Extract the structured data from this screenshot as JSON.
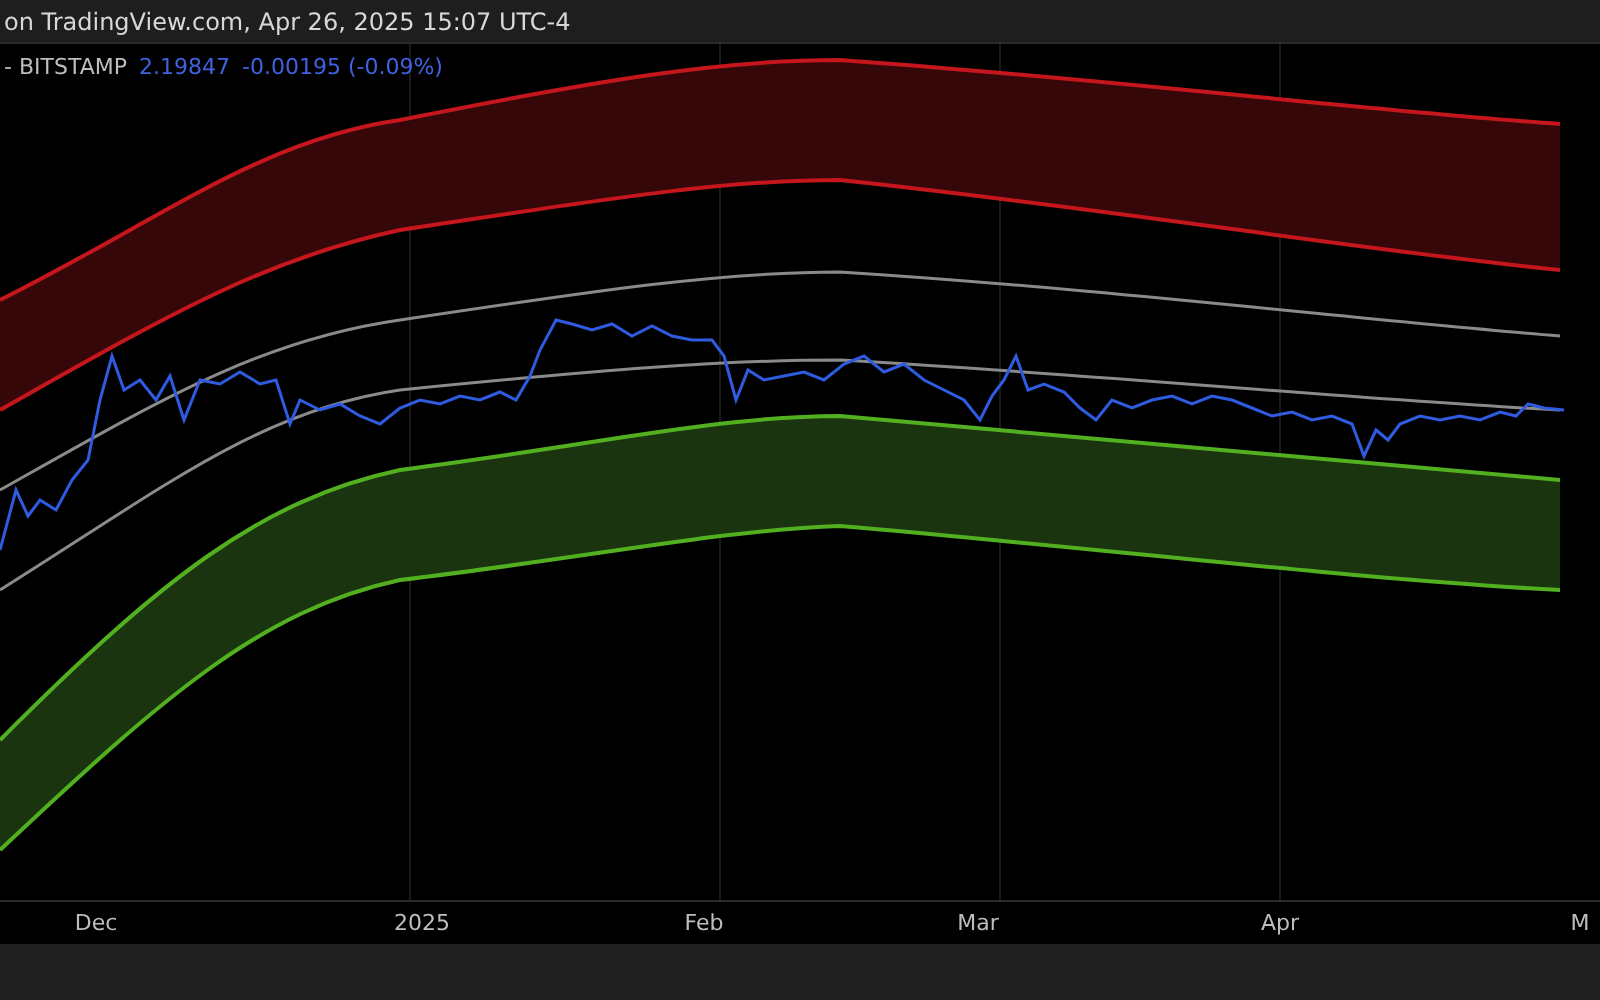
{
  "header": {
    "text": "on TradingView.com, Apr 26, 2025 15:07 UTC-4"
  },
  "legend": {
    "symbol": "- BITSTAMP",
    "price": "2.19847",
    "change": "-0.00195 (-0.09%)"
  },
  "x_axis": {
    "labels": [
      "Dec",
      "2025",
      "Feb",
      "Mar",
      "Apr",
      "M"
    ]
  }
}
